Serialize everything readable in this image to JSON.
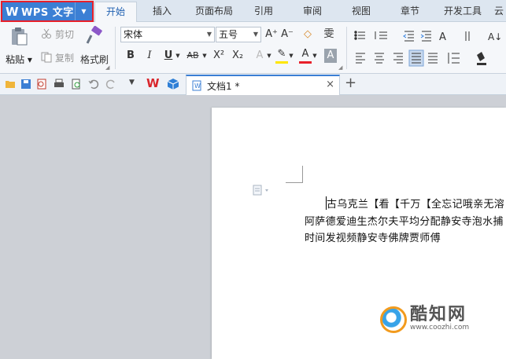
{
  "app": {
    "name": "WPS 文字",
    "logo": "W"
  },
  "menu_tabs": [
    "开始",
    "插入",
    "页面布局",
    "引用",
    "审阅",
    "视图",
    "章节",
    "开发工具",
    "云"
  ],
  "active_tab": "开始",
  "ribbon": {
    "paste_label": "粘贴",
    "cut_label": "剪切",
    "copy_label": "复制",
    "format_painter_label": "格式刷",
    "font_name": "宋体",
    "font_size": "五号",
    "grow_font": "A⁺",
    "shrink_font": "A⁻",
    "clear_format": "◇",
    "pinyin": "雯",
    "bold": "B",
    "italic": "I",
    "underline": "U",
    "strikethrough": "AB",
    "superscript": "X²",
    "subscript": "X₂",
    "text_effect": "A",
    "highlight": "✎",
    "font_color": "A",
    "char_shade": "A"
  },
  "doc_tab": {
    "name": "文档1 *",
    "close": "×",
    "new_tab": "+"
  },
  "document": {
    "lines": [
      "古乌克兰【看【千万【全忘记哦亲无溶",
      "阿萨德爱迪生杰尔夫平均分配静安寺泡水捕",
      "时间发视频静安寺佛牌贾师傅"
    ]
  },
  "watermark": {
    "text": "酷知网",
    "url": "www.coozhi.com"
  },
  "colors": {
    "accent": "#3b7fd4",
    "highlight_border": "#e8202a",
    "font_color_bar": "#e8202a",
    "highlight_bar": "#ffe600"
  }
}
